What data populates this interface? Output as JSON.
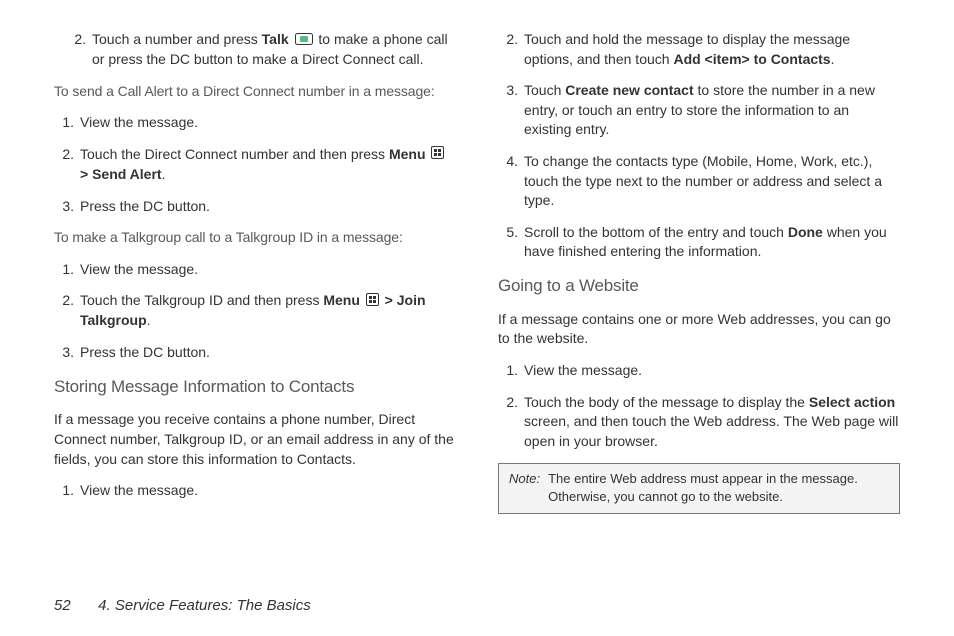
{
  "left": {
    "step2": {
      "num": "2.",
      "pre": "Touch a number and press ",
      "talk": "Talk",
      "post": " to make a phone call or press the DC button to make a Direct Connect call."
    },
    "leadA": "To send a Call Alert to a Direct Connect number in a message:",
    "a1": {
      "num": "1.",
      "txt": "View the message."
    },
    "a2": {
      "num": "2.",
      "pre": "Touch the Direct Connect number and then press ",
      "menu": "Menu",
      "gt": " > ",
      "send": "Send Alert",
      "dot": "."
    },
    "a3": {
      "num": "3.",
      "txt": "Press the DC button."
    },
    "leadB": "To make a Talkgroup call to a Talkgroup ID in a message:",
    "b1": {
      "num": "1.",
      "txt": "View the message."
    },
    "b2": {
      "num": "2.",
      "pre": "Touch the Talkgroup ID and then press ",
      "menu": "Menu",
      "gt": " > ",
      "join": "Join Talkgroup",
      "dot": "."
    },
    "b3": {
      "num": "3.",
      "txt": "Press the DC button."
    },
    "h1": "Storing Message Information to Contacts",
    "p1": "If a message you receive contains a phone number, Direct Connect number, Talkgroup ID, or an email address in any of the fields, you can store this information to Contacts.",
    "c1": {
      "num": "1.",
      "txt": "View the message."
    }
  },
  "right": {
    "r2": {
      "num": "2.",
      "pre": "Touch and hold the message to display the message options, and then touch ",
      "add": "Add <item> to Contacts",
      "dot": "."
    },
    "r3": {
      "num": "3.",
      "pre": "Touch ",
      "create": "Create new contact",
      "post": " to store the number in a new entry, or touch an entry to store the information to an existing entry."
    },
    "r4": {
      "num": "4.",
      "txt": "To change the contacts type (Mobile, Home, Work, etc.), touch the type next to the number or address and select a type."
    },
    "r5": {
      "num": "5.",
      "pre": "Scroll to the bottom of the entry and touch ",
      "done": "Done",
      "post": " when you have finished entering the information."
    },
    "h2": "Going to a Website",
    "p2": "If a message contains one or more Web addresses, you can go to the website.",
    "w1": {
      "num": "1.",
      "txt": "View the message."
    },
    "w2": {
      "num": "2.",
      "pre": "Touch the body of the message to display the ",
      "sel": "Select action",
      "post": " screen, and then touch the Web address. The Web page will open in your browser."
    },
    "note": {
      "label": "Note:",
      "text": "The entire Web address must appear in the message. Otherwise, you cannot go to the website."
    }
  },
  "footer": {
    "page": "52",
    "chapter": "4. Service Features: The Basics"
  }
}
